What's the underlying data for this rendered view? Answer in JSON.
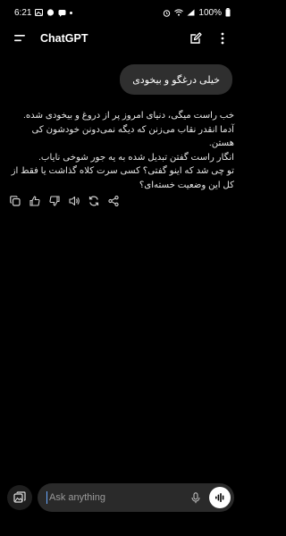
{
  "status_bar": {
    "time": "6:21",
    "battery": "100%",
    "icons": [
      "gallery-icon",
      "chat-bubble-icon",
      "message-icon",
      "dot-icon",
      "alarm-icon",
      "wifi-icon",
      "signal-icon",
      "battery-icon"
    ]
  },
  "app_bar": {
    "title": "ChatGPT",
    "icons": [
      "menu-icon",
      "new-chat-icon",
      "more-vert-icon"
    ]
  },
  "conversation": {
    "user_message": "خیلی درغگو و بیخودی",
    "assistant_lines": [
      "خب راست میگی، دنیای امروز پر از دروغ و بیخودی شده.",
      "آدما انقدر نقاب می‌زنن که دیگه نمی‌دونن خودشون کی هستن.",
      "انگار راست گفتن تبدیل شده به یه جور شوخی نایاب.",
      "تو چی شد که اینو گفتی؟ کسی سرت کلاه گذاشت یا فقط از",
      "کل این وضعیت خسته‌ای؟"
    ],
    "action_icons": [
      "copy-icon",
      "thumbs-up-icon",
      "thumbs-down-icon",
      "speaker-icon",
      "regenerate-icon",
      "share-icon"
    ]
  },
  "composer": {
    "placeholder": "Ask anything",
    "icons": [
      "attach-icon",
      "mic-icon",
      "voice-mode-icon"
    ]
  },
  "colors": {
    "background": "#000000",
    "bubble": "#2f2f2f",
    "input": "#2a2a2a",
    "text": "#ececec"
  }
}
